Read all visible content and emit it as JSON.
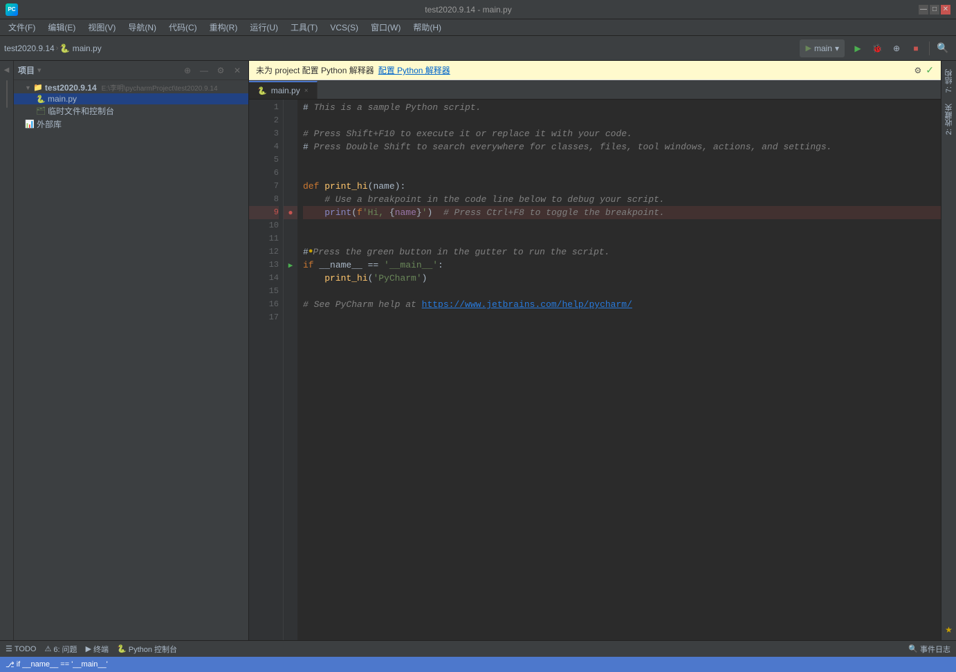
{
  "window": {
    "title": "test2020.9.14 - main.py",
    "minimize": "—",
    "maximize": "□",
    "close": "✕"
  },
  "menu": {
    "items": [
      "文件(F)",
      "编辑(E)",
      "视图(V)",
      "导航(N)",
      "代码(C)",
      "重构(R)",
      "运行(U)",
      "工具(T)",
      "VCS(S)",
      "窗口(W)",
      "帮助(H)"
    ]
  },
  "toolbar": {
    "breadcrumb_project": "test2020.9.14",
    "breadcrumb_file": "main.py",
    "run_config": "main",
    "run_config_dropdown": "▾"
  },
  "notification": {
    "text": "未为 project 配置 Python 解释器",
    "link_text": "配置 Python 解释器",
    "gear": "⚙",
    "checkmark": "✓"
  },
  "tab": {
    "filename": "main.py",
    "close": "×"
  },
  "project_panel": {
    "title": "项目",
    "dropdown": "▾",
    "add_icon": "⊕",
    "collapse_icon": "—",
    "settings_icon": "⚙"
  },
  "file_tree": {
    "items": [
      {
        "label": "test2020.9.14",
        "path": "E:\\李明\\pycharmProject\\test2020.9.14",
        "indent": 1,
        "type": "folder",
        "expanded": true
      },
      {
        "label": "main.py",
        "indent": 2,
        "type": "file-python",
        "selected": true
      },
      {
        "label": "临时文件和控制台",
        "indent": 2,
        "type": "folder-temp"
      },
      {
        "label": "外部库",
        "indent": 1,
        "type": "external-lib"
      }
    ]
  },
  "code": {
    "lines": [
      {
        "num": 1,
        "content": "# This is a sample Python script.",
        "type": "comment"
      },
      {
        "num": 2,
        "content": "",
        "type": "empty"
      },
      {
        "num": 3,
        "content": "# Press Shift+F10 to execute it or replace it with your code.",
        "type": "comment"
      },
      {
        "num": 4,
        "content": "# Press Double Shift to search everywhere for classes, files, tool windows, actions, and settings.",
        "type": "comment"
      },
      {
        "num": 5,
        "content": "",
        "type": "empty"
      },
      {
        "num": 6,
        "content": "",
        "type": "empty"
      },
      {
        "num": 7,
        "content": "def print_hi(name):",
        "type": "def"
      },
      {
        "num": 8,
        "content": "    # Use a breakpoint in the code line below to debug your script.",
        "type": "comment-indented"
      },
      {
        "num": 9,
        "content": "    print(f'Hi, {name}')  # Press Ctrl+F8 to toggle the breakpoint.",
        "type": "print-breakpoint",
        "highlighted": true
      },
      {
        "num": 10,
        "content": "",
        "type": "empty"
      },
      {
        "num": 11,
        "content": "",
        "type": "empty"
      },
      {
        "num": 12,
        "content": "# Press the green button in the gutter to run the script.",
        "type": "comment-hash-bullet"
      },
      {
        "num": 13,
        "content": "if __name__ == '__main__':",
        "type": "if-main",
        "run_arrow": true
      },
      {
        "num": 14,
        "content": "    print_hi('PyCharm')",
        "type": "print-call"
      },
      {
        "num": 15,
        "content": "",
        "type": "empty"
      },
      {
        "num": 16,
        "content": "# See PyCharm help at https://www.jetbrains.com/help/pycharm/",
        "type": "comment-url"
      },
      {
        "num": 17,
        "content": "",
        "type": "empty"
      }
    ]
  },
  "bottom_bar": {
    "todo": "TODO",
    "problems_icon": "⚠",
    "problems_label": "6: 问题",
    "terminal_icon": "▶",
    "terminal_label": "终端",
    "python_icon": "🐍",
    "python_label": "Python 控制台",
    "search_icon": "🔍",
    "event_log": "事件日志"
  },
  "status_bar": {
    "branch": "if __name__ == '__main__'",
    "git_icon": "⎇"
  },
  "right_panel": {
    "structure_label": "结构",
    "favorites_label": "收藏夹"
  }
}
